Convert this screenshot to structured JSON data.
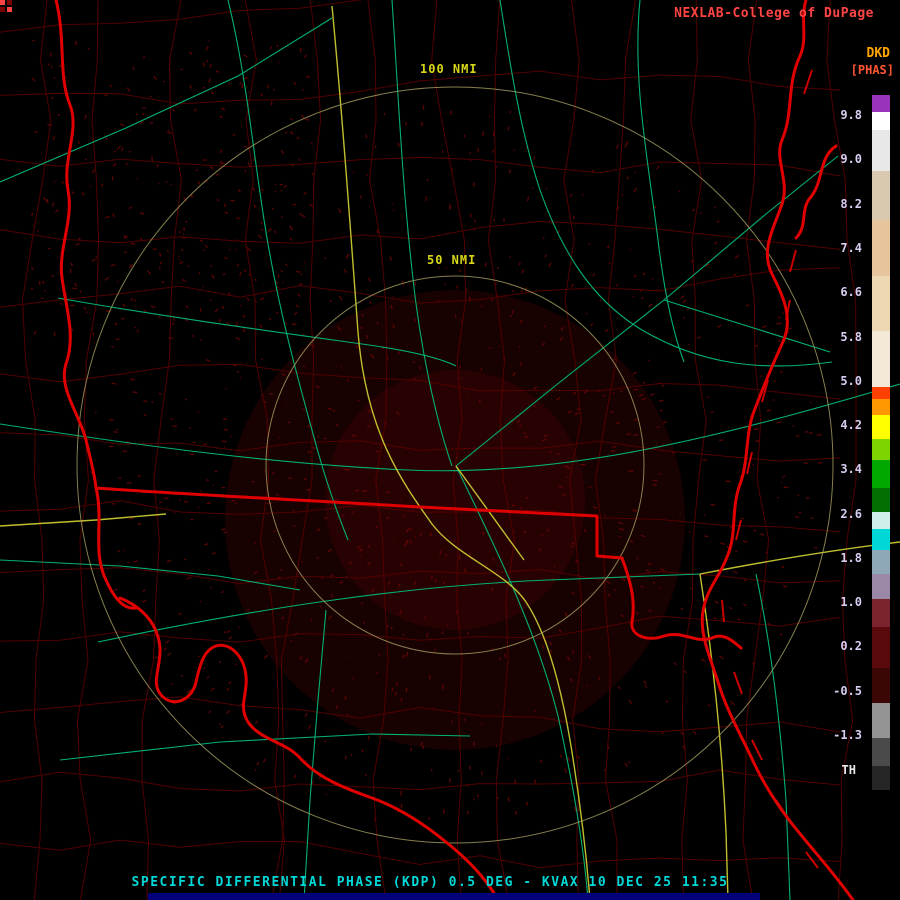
{
  "brand": {
    "text": "NEXLAB-College of DuPage"
  },
  "legend": {
    "product_code": "DKD",
    "units_label": "[PHAS]",
    "threshold_label": "TH",
    "ticks": [
      "9.8",
      "9.0",
      "8.2",
      "7.4",
      "6.6",
      "5.8",
      "5.0",
      "4.2",
      "3.4",
      "2.6",
      "1.8",
      "1.0",
      "0.2",
      "-0.5",
      "-1.3"
    ],
    "colorbar": [
      {
        "color": "#9933BB",
        "span": 2.5
      },
      {
        "color": "#FFFFFF",
        "span": 2.5
      },
      {
        "color": "#E8E8E8",
        "span": 6
      },
      {
        "color": "#D9C9AE",
        "span": 7
      },
      {
        "color": "#E6C49C",
        "span": 8
      },
      {
        "color": "#EED8B4",
        "span": 8
      },
      {
        "color": "#F4E9D6",
        "span": 8
      },
      {
        "color": "#FF4000",
        "span": 1.8
      },
      {
        "color": "#FF9800",
        "span": 2.2
      },
      {
        "color": "#FFFF00",
        "span": 3.5
      },
      {
        "color": "#7ED400",
        "span": 3
      },
      {
        "color": "#00A800",
        "span": 4
      },
      {
        "color": "#006E00",
        "span": 3.5
      },
      {
        "color": "#CFEFEA",
        "span": 2.5
      },
      {
        "color": "#00D8D8",
        "span": 3
      },
      {
        "color": "#8FA8B8",
        "span": 3.5
      },
      {
        "color": "#9B87A8",
        "span": 3.5
      },
      {
        "color": "#7A2430",
        "span": 4
      },
      {
        "color": "#5A0A0A",
        "span": 6
      },
      {
        "color": "#3A0606",
        "span": 5
      },
      {
        "color": "#949494",
        "span": 5
      },
      {
        "color": "#4A4A4A",
        "span": 4
      },
      {
        "color": "#262626",
        "span": 3.5
      }
    ]
  },
  "rings": {
    "outer_label": "100 NMI",
    "inner_label": "50 NMI"
  },
  "caption": {
    "text": "SPECIFIC DIFFERENTIAL PHASE (KDP) 0.5 DEG - KVAX 10 DEC 25 11:35"
  },
  "map_colors": {
    "state_border": "#E00000",
    "county_border": "#5A0000",
    "road_primary": "#00BA78",
    "road_highway": "#C9C930",
    "range_ring": "#A8A060",
    "echo": "#6B0606"
  }
}
